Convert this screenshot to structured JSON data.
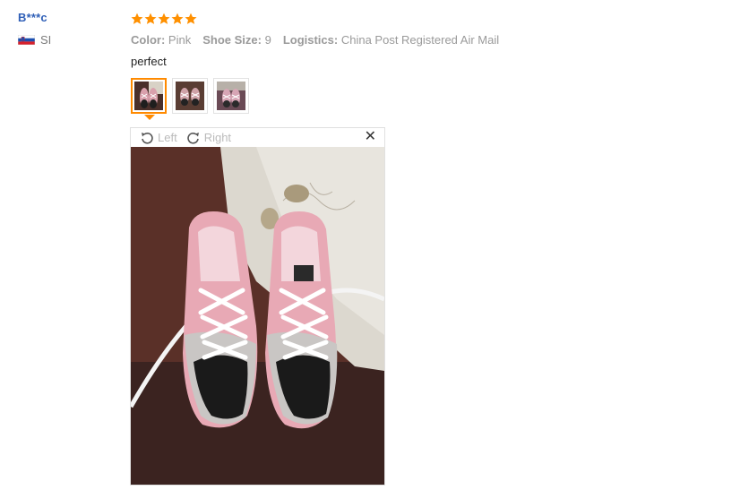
{
  "reviewer": {
    "name": "B***c",
    "country_code": "SI",
    "flag_icon": "slovenia-flag-icon"
  },
  "rating": {
    "stars": 5,
    "max": 5,
    "color": "#ff9000"
  },
  "attributes": [
    {
      "name": "Color:",
      "value": "Pink"
    },
    {
      "name": "Shoe Size:",
      "value": "9"
    },
    {
      "name": "Logistics:",
      "value": "China Post Registered Air Mail"
    }
  ],
  "comment": "perfect",
  "thumbnails": [
    {
      "icon": "photo-thumbnail",
      "active": true
    },
    {
      "icon": "photo-thumbnail",
      "active": false
    },
    {
      "icon": "photo-thumbnail",
      "active": false
    }
  ],
  "viewer": {
    "rotate_left_label": "Left",
    "rotate_right_label": "Right",
    "close_symbol": "✕",
    "image_icon": "sneakers-photo"
  },
  "colors": {
    "accent": "#ff8a00",
    "link": "#2f5fb7"
  }
}
